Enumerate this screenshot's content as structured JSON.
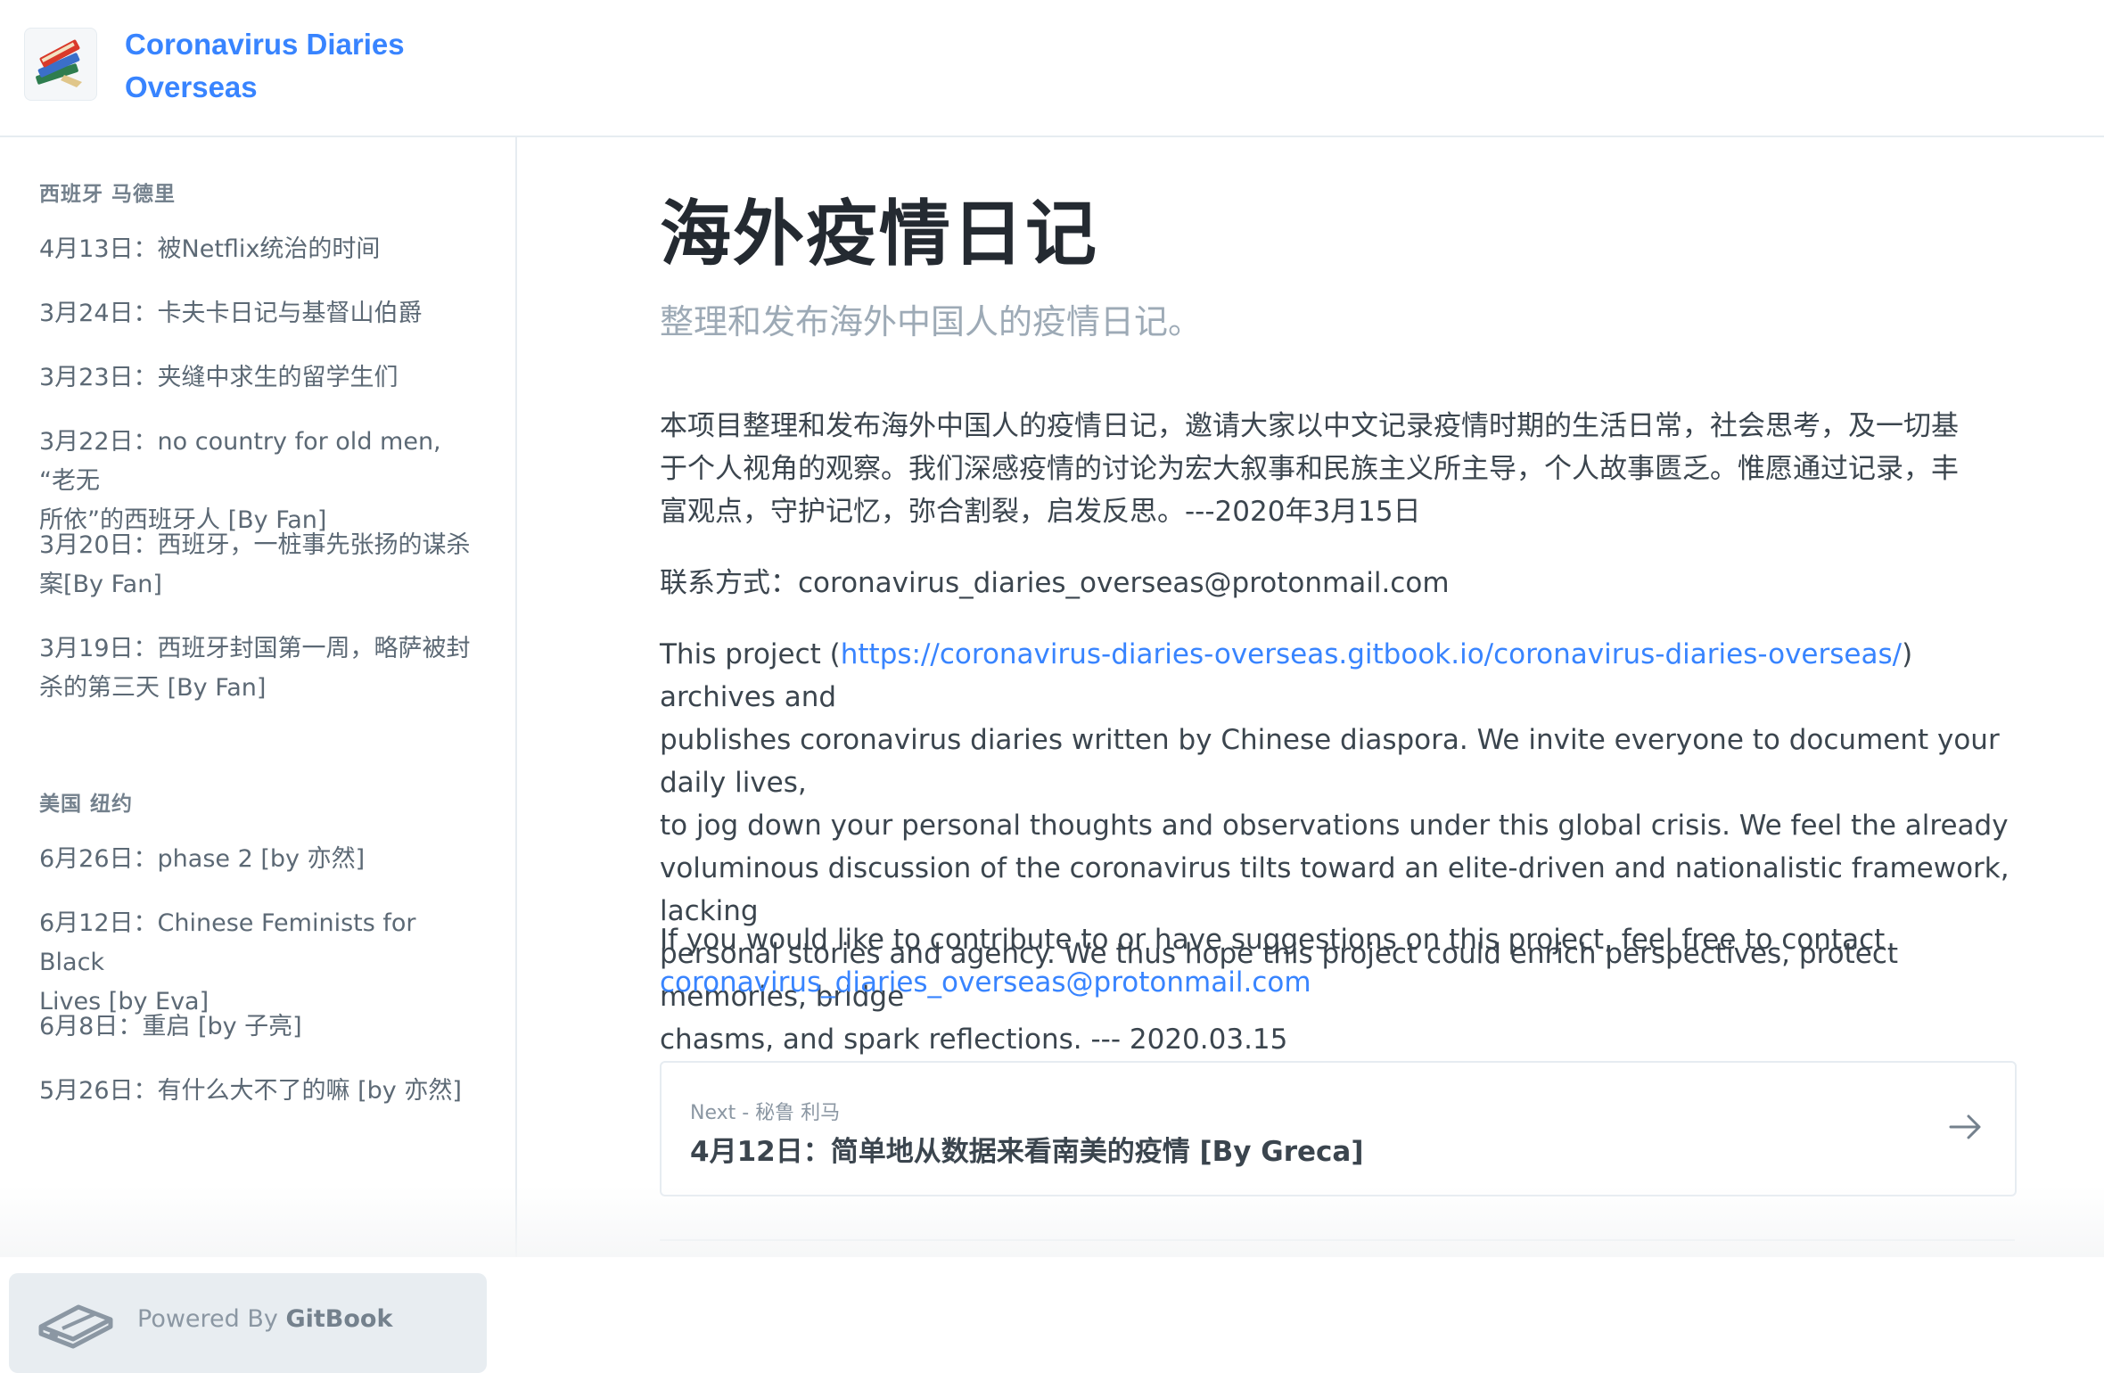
{
  "header": {
    "title_line1": "Coronavirus Diaries",
    "title_line2": "Overseas",
    "logo_icon": "books-icon"
  },
  "sidebar": {
    "groups": [
      {
        "label": "西班牙 马德里",
        "items": [
          {
            "lines": [
              "4月13日：被Netflix统治的时间"
            ]
          },
          {
            "lines": [
              "3月24日：卡夫卡日记与基督山伯爵"
            ]
          },
          {
            "lines": [
              "3月23日：夹缝中求生的留学生们"
            ]
          },
          {
            "lines": [
              "3月22日：no country for old men, “老无",
              "所依”的西班牙人 [By Fan]"
            ]
          },
          {
            "lines": [
              "3月20日：西班牙，一桩事先张扬的谋杀",
              "案[By Fan]"
            ]
          },
          {
            "lines": [
              "3月19日：西班牙封国第一周，略萨被封",
              "杀的第三天 [By Fan]"
            ]
          }
        ]
      },
      {
        "label": "美国 纽约",
        "items": [
          {
            "lines": [
              "6月26日：phase 2 [by 亦然]"
            ]
          },
          {
            "lines": [
              "6月12日：Chinese Feminists for Black",
              "Lives [by Eva]"
            ]
          },
          {
            "lines": [
              "6月8日：重启 [by 子亮]"
            ]
          },
          {
            "lines": [
              "5月26日：有什么大不了的嘛 [by 亦然]"
            ]
          }
        ]
      }
    ],
    "powered_prefix": "Powered By ",
    "powered_brand": "GitBook"
  },
  "main": {
    "title": "海外疫情日记",
    "subtitle": "整理和发布海外中国人的疫情日记。",
    "intro_cn_lines": [
      "本项目整理和发布海外中国人的疫情日记，邀请大家以中文记录疫情时期的生活日常，社会思考，及一切基",
      "于个人视角的观察。我们深感疫情的讨论为宏大叙事和民族主义所主导，个人故事匮乏。惟愿通过记录，丰",
      "富观点，守护记忆，弥合割裂，启发反思。---2020年3月15日"
    ],
    "contact_cn": "联系方式：coronavirus_diaries_overseas@protonmail.com",
    "intro_en_prefix": "This project (",
    "intro_en_link": "https://coronavirus-diaries-overseas.gitbook.io/coronavirus-diaries-overseas/",
    "intro_en_line1_suffix": ") archives and",
    "intro_en_lines": [
      "publishes coronavirus diaries written by Chinese diaspora. We invite everyone to document your daily lives,",
      "to jog down your personal thoughts and observations under this global crisis. We feel the already",
      "voluminous discussion of the coronavirus tilts toward an elite-driven and nationalistic framework, lacking",
      "personal stories and agency. We thus hope this project could enrich perspectives, protect memories, bridge",
      "chasms, and spark reflections. --- 2020.03.15"
    ],
    "contribute_text": "If you would like to contribute to or have suggestions on this project, feel free to contact",
    "contribute_email": "coronavirus_diaries_overseas@protonmail.com",
    "next": {
      "label": "Next - 秘鲁 利马",
      "title": "4月12日：简单地从数据来看南美的疫情 [By Greca]",
      "arrow_icon": "arrow-right-icon"
    }
  }
}
